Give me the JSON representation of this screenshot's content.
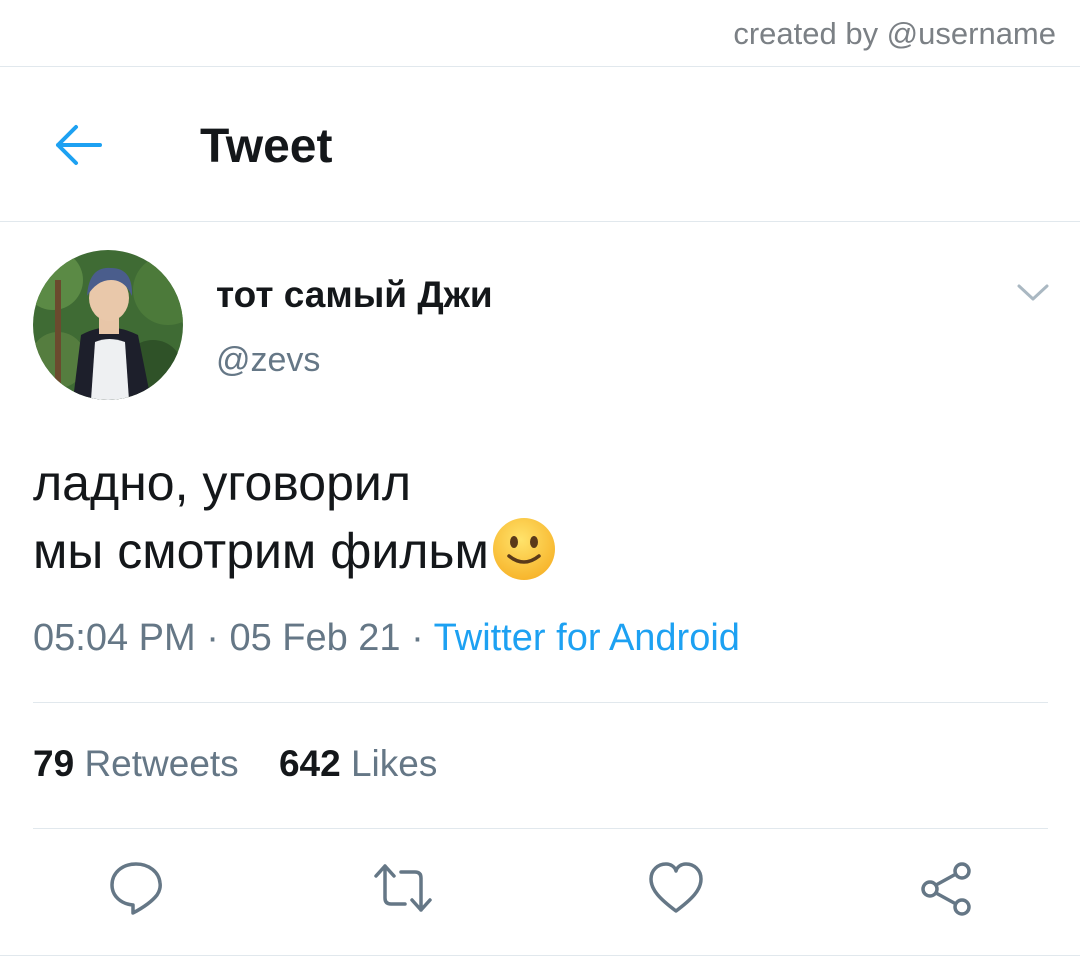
{
  "watermark": "created by @username",
  "header": {
    "title": "Tweet"
  },
  "tweet": {
    "display_name": "тот самый Джи",
    "handle": "@zevs",
    "text_lines": [
      "ладно, уговорил",
      "мы смотрим фильм"
    ],
    "time": "05:04 PM",
    "date": "05 Feb 21",
    "separator": " · ",
    "source": "Twitter for Android",
    "retweets": {
      "count": "79",
      "label": "Retweets"
    },
    "likes": {
      "count": "642",
      "label": "Likes"
    }
  },
  "icons": {
    "back": "arrow-left-icon",
    "more": "chevron-down-icon",
    "reply": "reply-icon",
    "retweet": "retweet-icon",
    "like": "heart-icon",
    "share": "share-icon",
    "emoji": "slightly-smiling-face"
  },
  "colors": {
    "accent": "#1da1f2",
    "text": "#14171a",
    "secondary": "#657786"
  }
}
